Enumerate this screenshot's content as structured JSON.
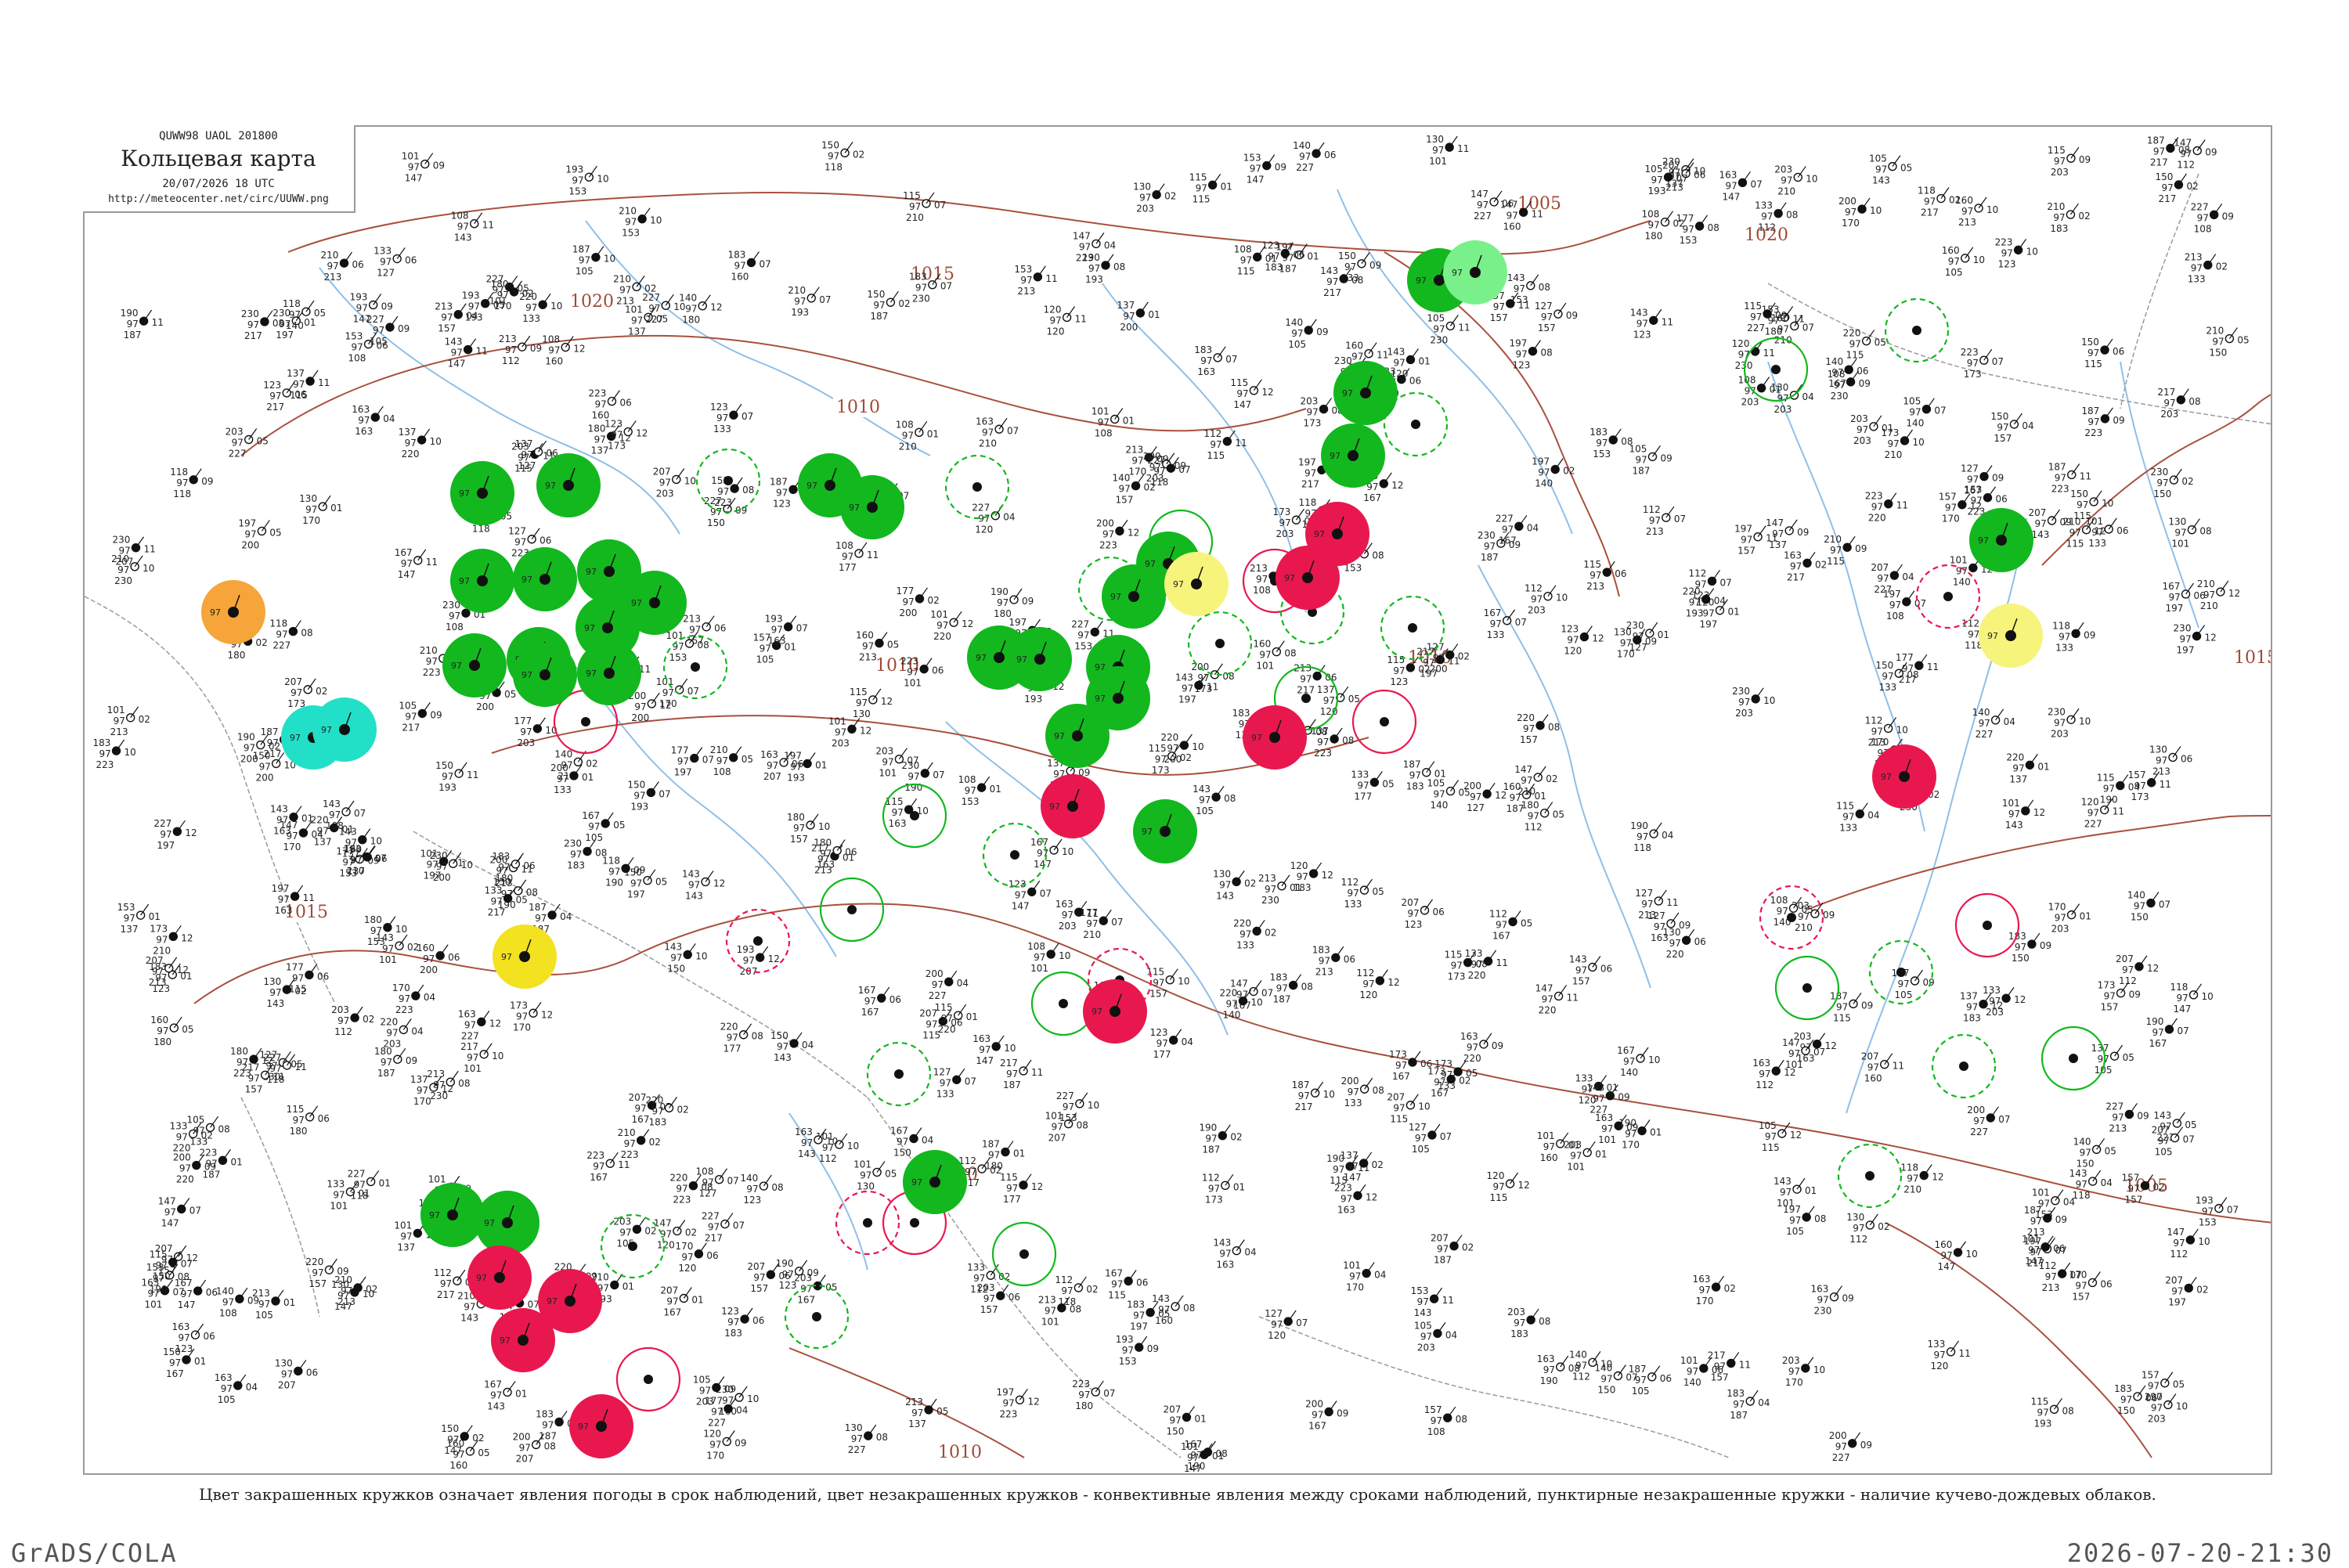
{
  "header": {
    "codes": "QUWW98  UAOL  201800",
    "title": "Кольцевая карта",
    "time": "20/07/2026 18 UTC",
    "url": "http://meteocenter.net/circ/UUWW.png"
  },
  "caption": "Цвет закрашенных кружков означает явления погоды в срок наблюдений, цвет незакрашенных кружков - конвективные явления между сроками наблюдений, пунктирные незакрашенные кружки - наличие кучево-дождевых облаков.",
  "footer": {
    "left": "GrADS/COLA",
    "right": "2026-07-20-21:30"
  },
  "colors": {
    "green": "#12b81e",
    "red": "#e8184f",
    "cyan": "#22e0c8",
    "orange": "#f5a53a",
    "yellow": "#f2e21f",
    "paleyellow": "#f7f47c",
    "lightgreen": "#7af08a",
    "isobar": "#a8503e",
    "river": "#8fbfe8"
  },
  "isobar_labels": [
    "1020",
    "1015",
    "1010",
    "1005",
    "1020",
    "1010",
    "1015",
    "1020",
    "1010",
    "1015",
    "1005",
    "1010"
  ],
  "filled_circles": [
    {
      "color": "green",
      "label": "97"
    },
    {
      "color": "green",
      "label": "97"
    },
    {
      "color": "green",
      "label": "97"
    },
    {
      "color": "green",
      "label": "97"
    },
    {
      "color": "green",
      "label": "97"
    },
    {
      "color": "green",
      "label": "97"
    },
    {
      "color": "green",
      "label": "97"
    },
    {
      "color": "green",
      "label": "97"
    },
    {
      "color": "green",
      "label": "97"
    },
    {
      "color": "green",
      "label": "97"
    },
    {
      "color": "green",
      "label": "97"
    },
    {
      "color": "green",
      "label": "97"
    },
    {
      "color": "green",
      "label": "97"
    },
    {
      "color": "green",
      "label": "97"
    },
    {
      "color": "green",
      "label": "97"
    },
    {
      "color": "green",
      "label": "97"
    },
    {
      "color": "green",
      "label": "97"
    },
    {
      "color": "green",
      "label": "97"
    },
    {
      "color": "green",
      "label": "97"
    },
    {
      "color": "green",
      "label": "97"
    },
    {
      "color": "green",
      "label": "97"
    },
    {
      "color": "green",
      "label": "97"
    },
    {
      "color": "green",
      "label": "97"
    },
    {
      "color": "green",
      "label": "97"
    },
    {
      "color": "green",
      "label": "97"
    },
    {
      "color": "green",
      "label": "97"
    },
    {
      "color": "green",
      "label": "97"
    },
    {
      "color": "green",
      "label": "97"
    },
    {
      "color": "red",
      "label": "97"
    },
    {
      "color": "red",
      "label": "97"
    },
    {
      "color": "red",
      "label": "97"
    },
    {
      "color": "red",
      "label": "97"
    },
    {
      "color": "red",
      "label": "97"
    },
    {
      "color": "red",
      "label": "97"
    },
    {
      "color": "red",
      "label": "97"
    },
    {
      "color": "red",
      "label": "97"
    },
    {
      "color": "red",
      "label": "97"
    },
    {
      "color": "red",
      "label": "97"
    },
    {
      "color": "cyan",
      "label": "97"
    },
    {
      "color": "cyan",
      "label": "97"
    },
    {
      "color": "orange",
      "label": "97"
    },
    {
      "color": "yellow",
      "label": "97"
    },
    {
      "color": "paleyellow",
      "label": "97"
    },
    {
      "color": "paleyellow",
      "label": "97"
    },
    {
      "color": "lightgreen",
      "label": "97"
    }
  ],
  "ring_circles": [
    {
      "color": "green",
      "dashed": true
    },
    {
      "color": "green",
      "dashed": true
    },
    {
      "color": "green",
      "dashed": false
    },
    {
      "color": "red",
      "dashed": false
    },
    {
      "color": "green",
      "dashed": true
    },
    {
      "color": "red",
      "dashed": true
    },
    {
      "color": "green",
      "dashed": false
    },
    {
      "color": "green",
      "dashed": true
    },
    {
      "color": "red",
      "dashed": false
    },
    {
      "color": "green",
      "dashed": true
    },
    {
      "color": "green",
      "dashed": false
    },
    {
      "color": "red",
      "dashed": true
    },
    {
      "color": "green",
      "dashed": true
    },
    {
      "color": "green",
      "dashed": false
    },
    {
      "color": "green",
      "dashed": true
    },
    {
      "color": "red",
      "dashed": false
    },
    {
      "color": "green",
      "dashed": true
    },
    {
      "color": "green",
      "dashed": false
    },
    {
      "color": "red",
      "dashed": true
    },
    {
      "color": "green",
      "dashed": true
    },
    {
      "color": "green",
      "dashed": true
    },
    {
      "color": "red",
      "dashed": false
    },
    {
      "color": "green",
      "dashed": false
    },
    {
      "color": "green",
      "dashed": true
    },
    {
      "color": "red",
      "dashed": true
    },
    {
      "color": "green",
      "dashed": false
    },
    {
      "color": "green",
      "dashed": true
    },
    {
      "color": "green",
      "dashed": true
    },
    {
      "color": "red",
      "dashed": false
    },
    {
      "color": "green",
      "dashed": false
    },
    {
      "color": "green",
      "dashed": true
    },
    {
      "color": "red",
      "dashed": true
    },
    {
      "color": "green",
      "dashed": false
    },
    {
      "color": "green",
      "dashed": true
    },
    {
      "color": "red",
      "dashed": false
    },
    {
      "color": "green",
      "dashed": true
    }
  ],
  "station_values": [
    "97",
    "01",
    "02",
    "04",
    "05",
    "06",
    "07",
    "08",
    "09",
    "10",
    "11",
    "12",
    "101",
    "105",
    "108",
    "112",
    "115",
    "118",
    "120",
    "123",
    "127",
    "130",
    "133",
    "137",
    "140",
    "143",
    "147",
    "150",
    "153",
    "157",
    "160",
    "163",
    "167",
    "170",
    "173",
    "177",
    "180",
    "183",
    "187",
    "190",
    "193",
    "197",
    "200",
    "203",
    "207",
    "210",
    "213",
    "217",
    "220",
    "223",
    "227",
    "230"
  ]
}
